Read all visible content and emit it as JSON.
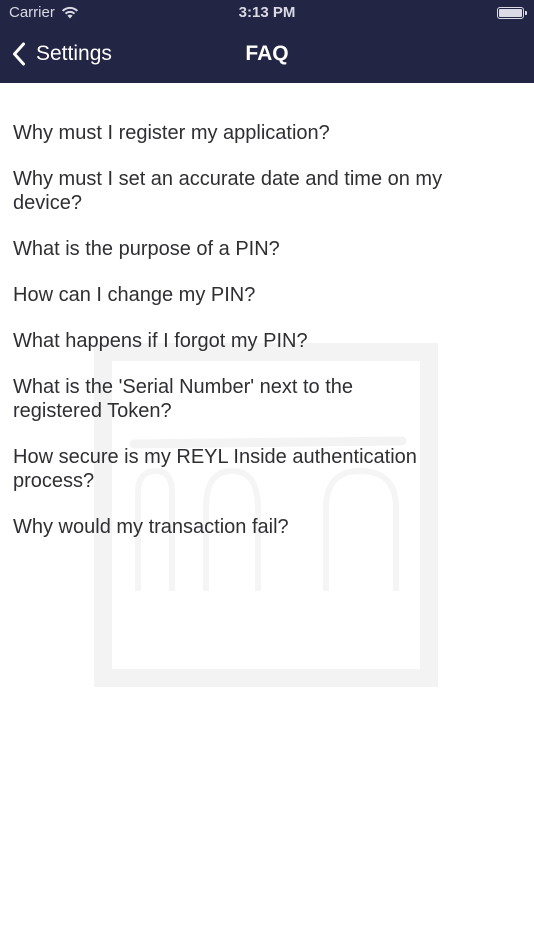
{
  "status_bar": {
    "carrier": "Carrier",
    "time": "3:13 PM",
    "icons": [
      "wifi-icon",
      "battery-icon"
    ]
  },
  "nav_bar": {
    "back_label": "Settings",
    "back_icon": "chevron-left-icon",
    "title": "FAQ",
    "background_color": "#232544"
  },
  "faq": {
    "items": [
      "Why must I register my application?",
      "Why must I set an accurate date and time on my device?",
      "What is the purpose of a PIN?",
      "How can I change my PIN?",
      "What happens if I forgot my PIN?",
      "What is the 'Serial Number' next to the registered Token?",
      "How secure is my REYL Inside authentication process?",
      "Why would my transaction fail?"
    ]
  },
  "background": {
    "watermark_icon": "bank-logo-watermark-icon"
  }
}
